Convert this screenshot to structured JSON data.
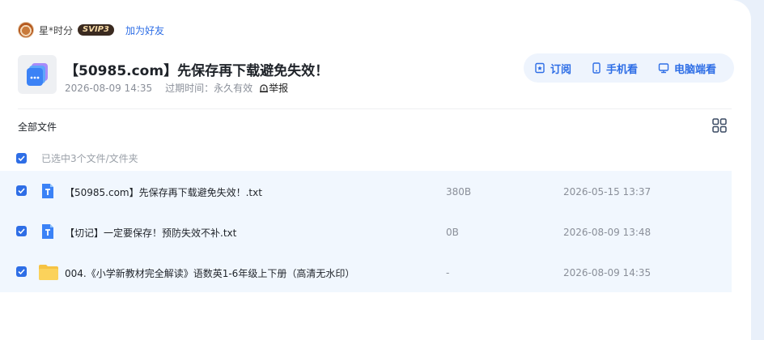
{
  "user": {
    "name": "星*时分",
    "vip": "SVIP3",
    "add_friend": "加为好友"
  },
  "share": {
    "title": "【50985.com】先保存再下载避免失效！.…",
    "date": "2026-08-09 14:35",
    "expire_label": "过期时间：",
    "expire_value": "永久有效",
    "report": "举报"
  },
  "actions": {
    "subscribe": "订阅",
    "mobile": "手机看",
    "desktop": "电脑端看"
  },
  "list": {
    "heading": "全部文件",
    "selected_text": "已选中3个文件/文件夹",
    "files": [
      {
        "name": "【50985.com】先保存再下载避免失效！.txt",
        "size": "380B",
        "date": "2026-05-15 13:37",
        "type": "txt"
      },
      {
        "name": "【切记】一定要保存！预防失效不补.txt",
        "size": "0B",
        "date": "2026-08-09 13:48",
        "type": "txt"
      },
      {
        "name": "004.《小学新教材完全解读》语数英1-6年级上下册（高清无水印）",
        "size": "-",
        "date": "2026-08-09 14:35",
        "type": "folder"
      }
    ]
  },
  "colors": {
    "accent": "#2e6ee6",
    "row_bg": "#f1f7fe",
    "txt_icon": "#3b82f6",
    "folder": "#f6c343"
  }
}
